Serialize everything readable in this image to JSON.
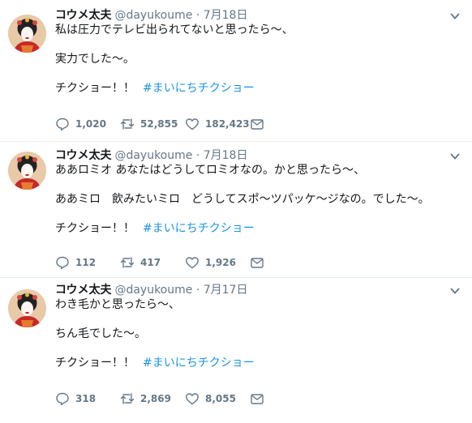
{
  "tweets": [
    {
      "name": "コウメ太夫",
      "handle": "@dayukoume",
      "sep": "·",
      "date": "7月18日",
      "lines": [
        "私は圧力でテレビ出られてないと思ったら～、",
        "",
        "実力でした～。",
        ""
      ],
      "punch": "チクショー！！",
      "hashtag": "#まいにちチクショー",
      "replies": "1,020",
      "retweets": "52,855",
      "likes": "182,423"
    },
    {
      "name": "コウメ太夫",
      "handle": "@dayukoume",
      "sep": "·",
      "date": "7月18日",
      "lines": [
        "ああロミオ あなたはどうしてロミオなの。かと思ったら～、",
        "",
        "ああミロ　飲みたいミロ　どうしてスポ～ツパッケ～ジなの。でした～。",
        ""
      ],
      "punch": "チクショー！！",
      "hashtag": "#まいにちチクショー",
      "replies": "112",
      "retweets": "417",
      "likes": "1,926"
    },
    {
      "name": "コウメ太夫",
      "handle": "@dayukoume",
      "sep": "·",
      "date": "7月17日",
      "lines": [
        "わき毛かと思ったら～、",
        "",
        "ちん毛でした～。",
        ""
      ],
      "punch": "チクショー！！",
      "hashtag": "#まいにちチクショー",
      "replies": "318",
      "retweets": "2,869",
      "likes": "8,055"
    }
  ],
  "icons": [
    "avatar-image",
    "chevron-down-icon",
    "reply-icon",
    "retweet-icon",
    "like-icon",
    "direct-message-icon"
  ],
  "colors": {
    "text": "#14171a",
    "muted": "#657786",
    "link": "#1b95e0",
    "divider": "#e6ecf0"
  }
}
